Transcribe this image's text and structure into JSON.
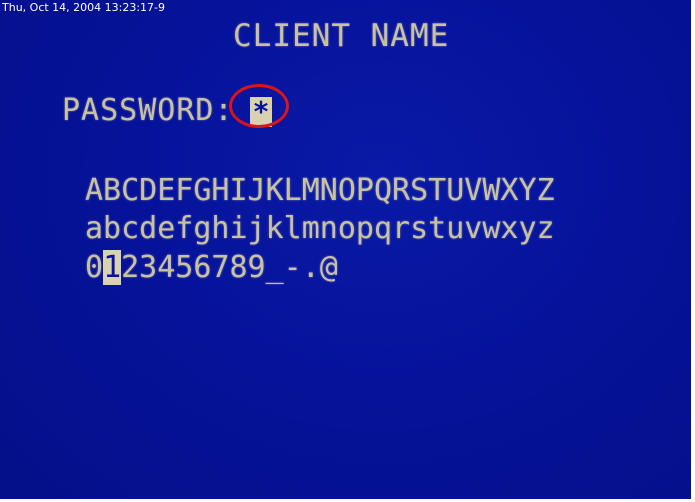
{
  "timestamp": "Thu, Oct 14, 2004 13:23:17-9",
  "title": "CLIENT NAME",
  "password": {
    "label": "PASSWORD:",
    "value": "*"
  },
  "charset": {
    "uppercase": "ABCDEFGHIJKLMNOPQRSTUVWXYZ",
    "lowercase": "abcdefghijklmnopqrstuvwxyz",
    "digits_before": "0",
    "digits_selected": "1",
    "digits_after": "23456789_-.@"
  },
  "colors": {
    "background": "#06129a",
    "osd_text": "#c9c2a0",
    "highlight": "#d9141a"
  }
}
